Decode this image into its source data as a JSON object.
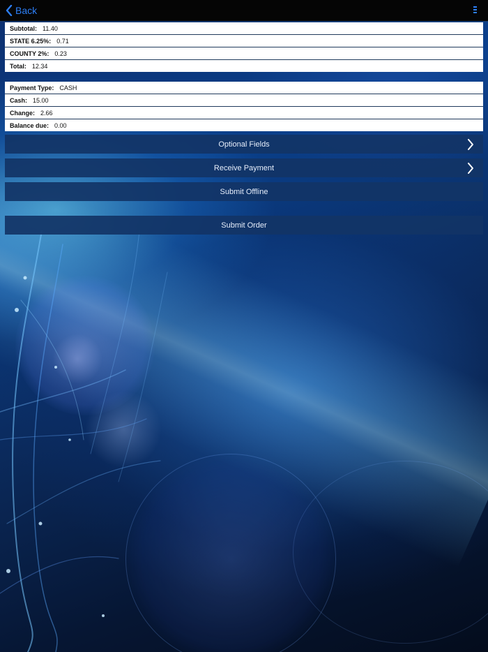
{
  "nav": {
    "back_label": "Back"
  },
  "summary": [
    {
      "label": "Subtotal:",
      "value": "11.40"
    },
    {
      "label": "STATE 6.25%:",
      "value": "0.71"
    },
    {
      "label": "COUNTY 2%:",
      "value": "0.23"
    },
    {
      "label": "Total:",
      "value": "12.34"
    }
  ],
  "payment": [
    {
      "label": "Payment Type:",
      "value": "CASH"
    },
    {
      "label": "Cash:",
      "value": "15.00"
    },
    {
      "label": "Change:",
      "value": "2.66"
    },
    {
      "label": "Balance due:",
      "value": "0.00"
    }
  ],
  "actions": {
    "optional_fields": "Optional Fields",
    "receive_payment": "Receive Payment",
    "submit_offline": "Submit Offline",
    "submit_order": "Submit Order"
  },
  "icons": {
    "back": "chevron-left-icon",
    "menu": "menu-icon",
    "row_chevron": "chevron-right-icon"
  },
  "colors": {
    "accent": "#2d7ff6",
    "navbar": "#050505",
    "button": "#123466"
  }
}
